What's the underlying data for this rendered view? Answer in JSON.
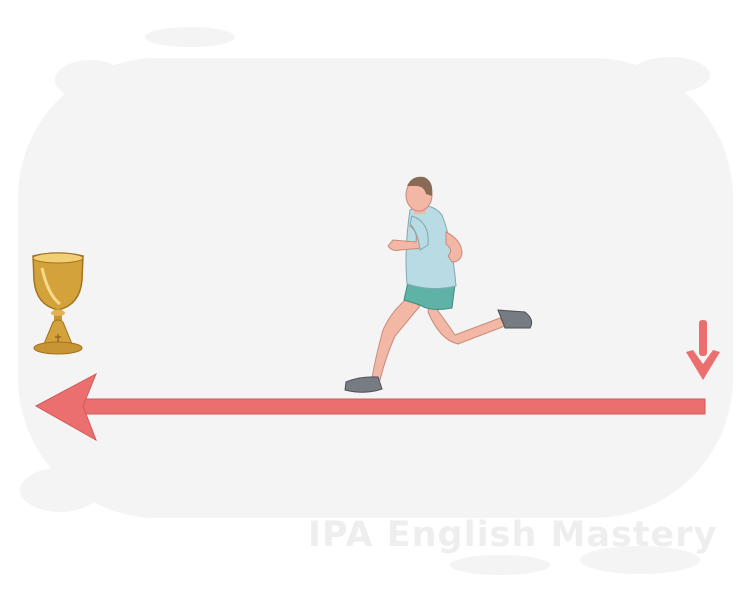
{
  "scene": {
    "colors": {
      "backdrop": "#f4f4f4",
      "arrow": "#ec6f6f",
      "goblet_gold": "#d4a23a",
      "shirt": "#b9dbe3",
      "shorts": "#5fb3a6",
      "skin": "#f3b7a6",
      "shoes": "#777b82"
    },
    "icons": [
      "goblet-icon",
      "runner-figure",
      "start-marker-arrow",
      "direction-arrow"
    ]
  },
  "watermark": "IPA English Mastery"
}
